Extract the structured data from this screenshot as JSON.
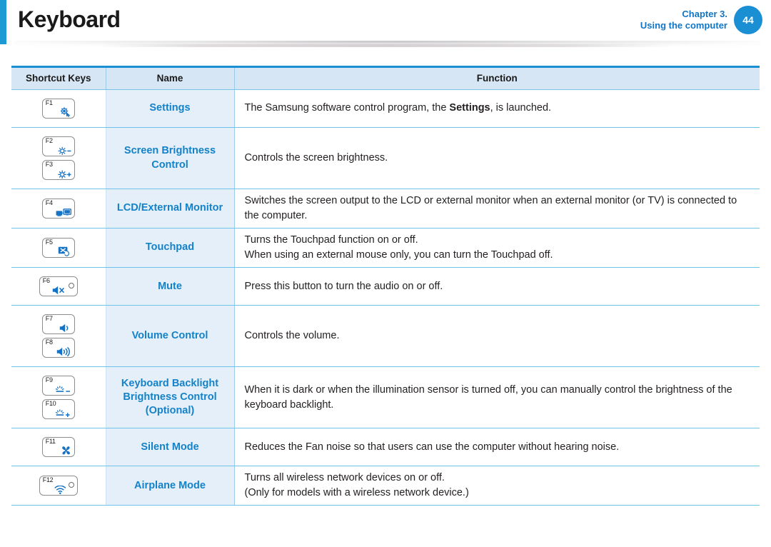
{
  "header": {
    "title": "Keyboard",
    "chapter_line1": "Chapter 3.",
    "chapter_line2": "Using the computer",
    "page_number": "44",
    "accent_color": "#1b9ad6",
    "link_color": "#1275c4"
  },
  "table": {
    "columns": [
      "Shortcut Keys",
      "Name",
      "Function"
    ],
    "rows": [
      {
        "keys": [
          {
            "label": "F1",
            "icon": "settings-gear-cursor-icon",
            "led": false
          }
        ],
        "name": "Settings",
        "function_prefix": "The Samsung software control program, the ",
        "function_bold": "Settings",
        "function_suffix": ", is launched.",
        "function_lines": []
      },
      {
        "keys": [
          {
            "label": "F2",
            "icon": "brightness-down-icon",
            "led": false
          },
          {
            "label": "F3",
            "icon": "brightness-up-icon",
            "led": false
          }
        ],
        "name": "Screen Brightness Control",
        "function_lines": [
          "Controls the screen brightness."
        ]
      },
      {
        "keys": [
          {
            "label": "F4",
            "icon": "external-monitor-icon",
            "led": false
          }
        ],
        "name": "LCD/External Monitor",
        "function_lines": [
          "Switches the screen output to the LCD or external monitor when an external monitor (or TV) is connected to the computer."
        ]
      },
      {
        "keys": [
          {
            "label": "F5",
            "icon": "touchpad-icon",
            "led": false
          }
        ],
        "name": "Touchpad",
        "function_lines": [
          "Turns the Touchpad function on or off.",
          "When using an external mouse only, you can turn the Touchpad off."
        ]
      },
      {
        "keys": [
          {
            "label": "F6",
            "icon": "mute-speaker-icon",
            "led": true
          }
        ],
        "name": "Mute",
        "function_lines": [
          "Press this button to turn the audio on or off."
        ]
      },
      {
        "keys": [
          {
            "label": "F7",
            "icon": "volume-down-icon",
            "led": false
          },
          {
            "label": "F8",
            "icon": "volume-up-icon",
            "led": false
          }
        ],
        "name": "Volume Control",
        "function_lines": [
          "Controls the volume."
        ]
      },
      {
        "keys": [
          {
            "label": "F9",
            "icon": "keyboard-backlight-down-icon",
            "led": false
          },
          {
            "label": "F10",
            "icon": "keyboard-backlight-up-icon",
            "led": false
          }
        ],
        "name": "Keyboard Backlight Brightness Control (Optional)",
        "name_lines": [
          "Keyboard Backlight",
          "Brightness Control",
          "(Optional)"
        ],
        "function_lines": [
          "When it is dark or when the illumination sensor is turned off, you can manually control the brightness of the keyboard backlight."
        ]
      },
      {
        "keys": [
          {
            "label": "F11",
            "icon": "fan-icon",
            "led": false
          }
        ],
        "name": "Silent Mode",
        "function_lines": [
          "Reduces the Fan noise so that users can use the computer without hearing noise."
        ]
      },
      {
        "keys": [
          {
            "label": "F12",
            "icon": "wifi-icon",
            "led": true
          }
        ],
        "name": "Airplane Mode",
        "function_lines": [
          "Turns all wireless network devices on or off.",
          "(Only for models with a wireless network device.)"
        ]
      }
    ]
  }
}
